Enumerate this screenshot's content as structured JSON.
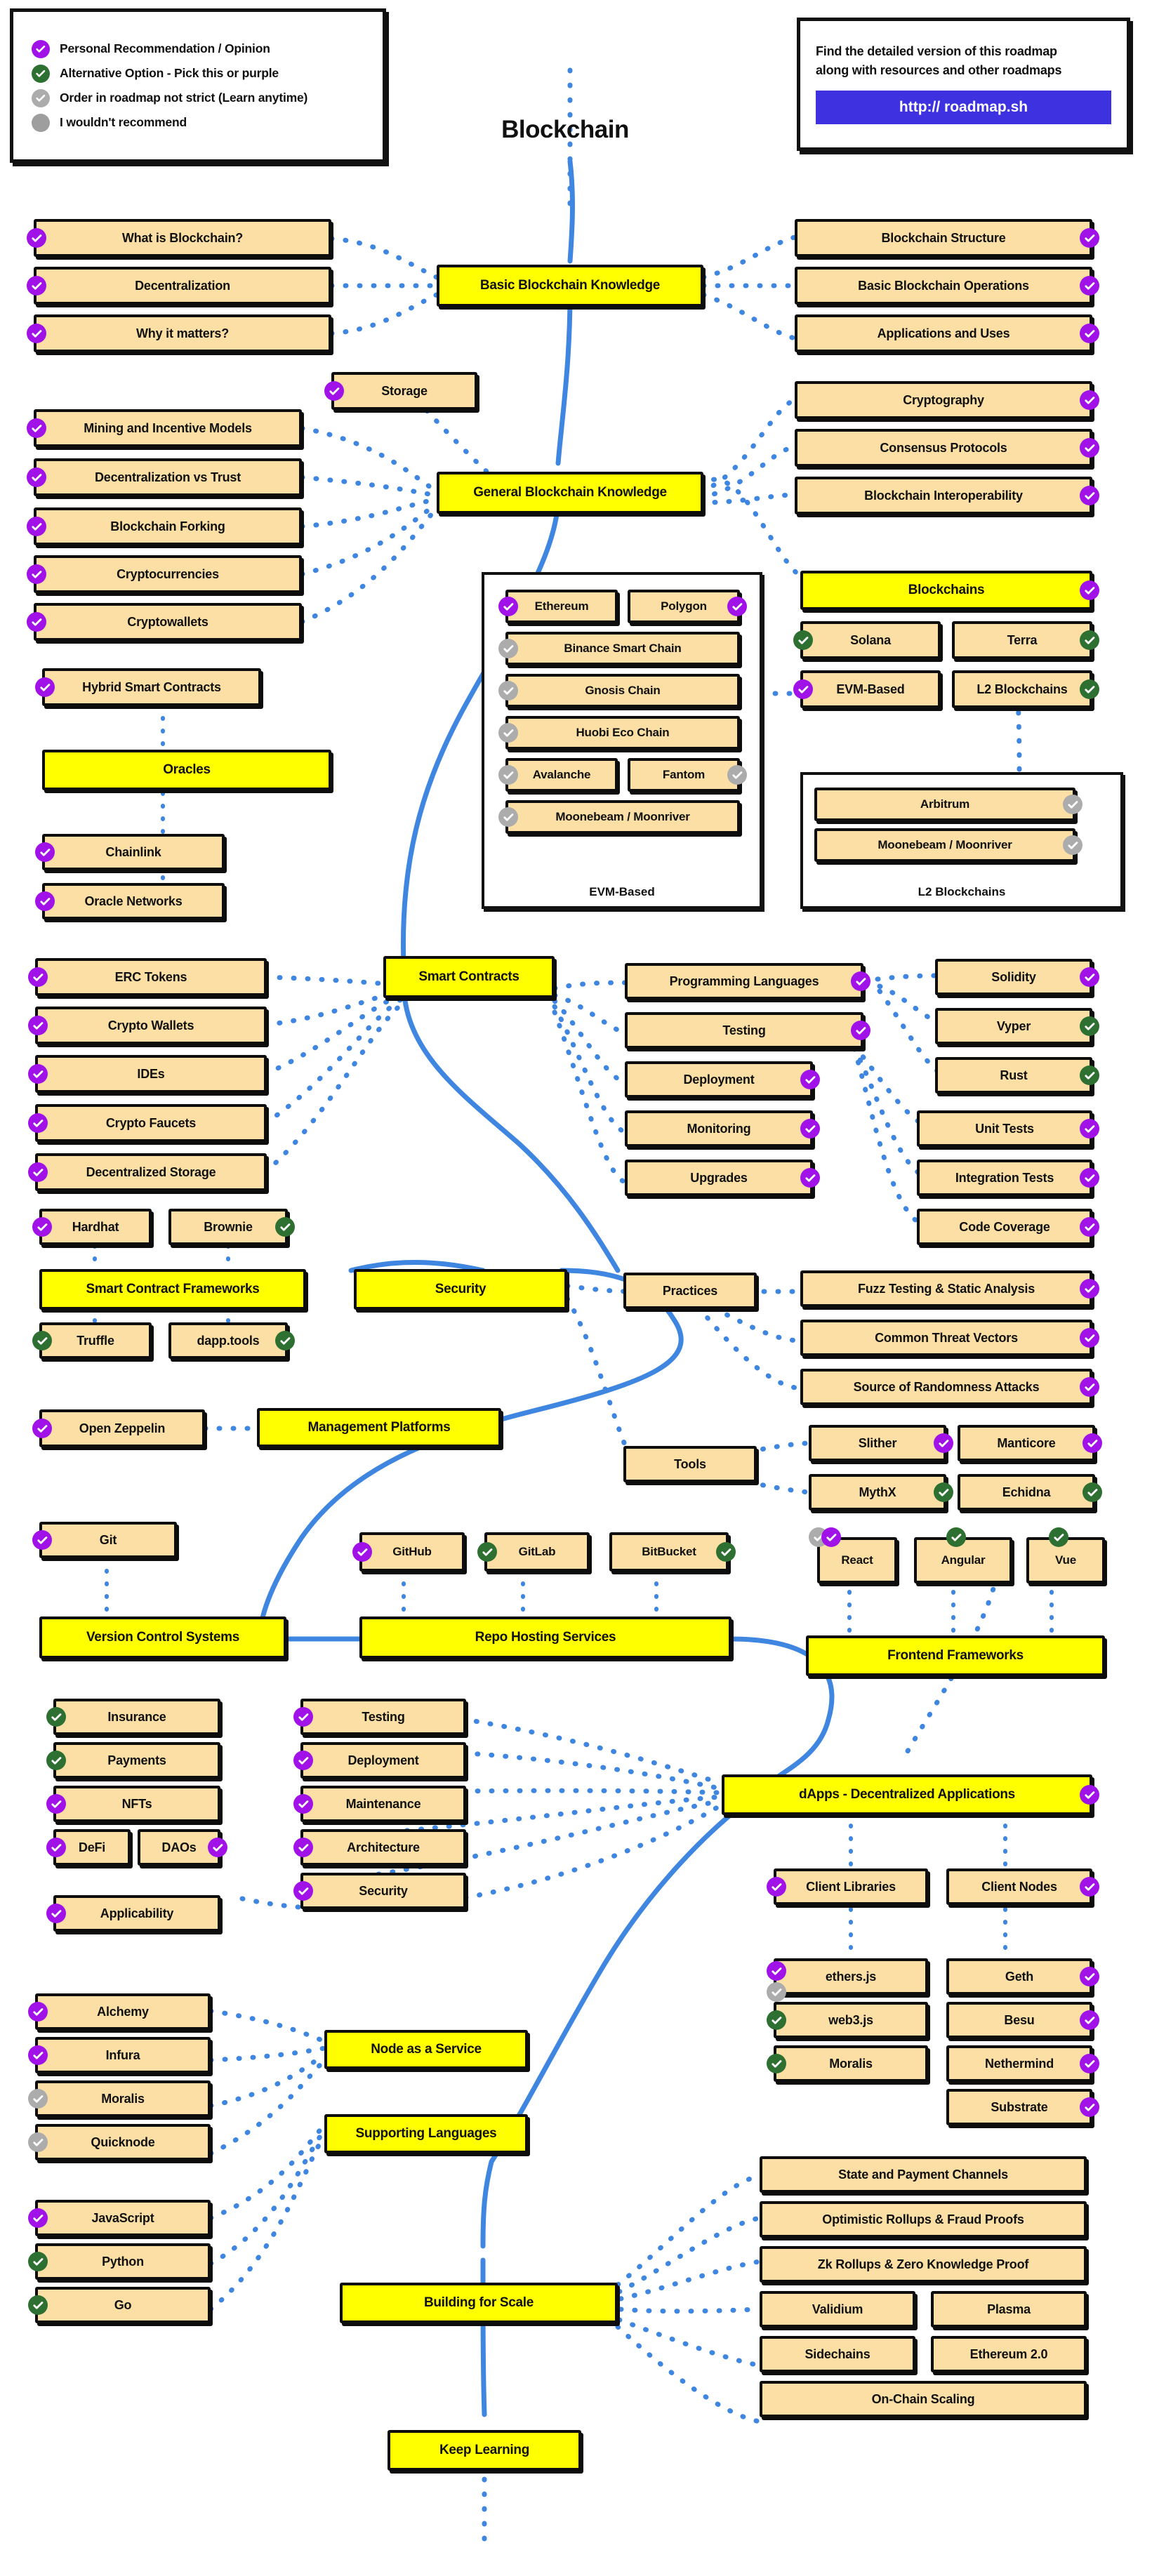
{
  "title": "Blockchain",
  "legend": {
    "items": [
      {
        "color": "purple",
        "icon": "check-circle-icon",
        "label": "Personal Recommendation / Opinion"
      },
      {
        "color": "green",
        "icon": "check-circle-icon",
        "label": "Alternative Option - Pick this or purple"
      },
      {
        "color": "gray",
        "icon": "check-circle-icon",
        "label": "Order in roadmap not strict (Learn anytime)"
      },
      {
        "color": "plain",
        "icon": "filled-circle-icon",
        "label": "I wouldn't recommend"
      }
    ]
  },
  "info": {
    "line1": "Find the detailed version of this roadmap",
    "line2": "along with resources and other roadmaps",
    "button": "http:// roadmap.sh"
  },
  "colors": {
    "purple": "#a112e8",
    "green": "#2e7031",
    "gray": "#acacac",
    "node_fill": "#fbdfa4",
    "main_fill": "#ffff00",
    "link_blue": "#3f86e0",
    "button_blue": "#3d31e0",
    "outline": "#0d0d0d"
  },
  "groups": [
    {
      "id": "evm_group",
      "caption": "EVM-Based"
    },
    {
      "id": "l2_group",
      "caption": "L2 Blockchains"
    }
  ],
  "nodes": [
    {
      "id": "n0",
      "label": "Basic Blockchain Knowledge",
      "main": true
    },
    {
      "id": "n1",
      "label": "What is Blockchain?"
    },
    {
      "id": "n2",
      "label": "Decentralization"
    },
    {
      "id": "n3",
      "label": "Why it matters?"
    },
    {
      "id": "n4",
      "label": "Blockchain Structure"
    },
    {
      "id": "n5",
      "label": "Basic Blockchain Operations"
    },
    {
      "id": "n6",
      "label": "Applications and Uses"
    },
    {
      "id": "n7",
      "label": "General Blockchain Knowledge",
      "main": true
    },
    {
      "id": "n8",
      "label": "Storage"
    },
    {
      "id": "n9",
      "label": "Mining and Incentive Models"
    },
    {
      "id": "n10",
      "label": "Decentralization vs Trust"
    },
    {
      "id": "n11",
      "label": "Blockchain Forking"
    },
    {
      "id": "n12",
      "label": "Cryptocurrencies"
    },
    {
      "id": "n13",
      "label": "Cryptowallets"
    },
    {
      "id": "n14",
      "label": "Cryptography"
    },
    {
      "id": "n15",
      "label": "Consensus Protocols"
    },
    {
      "id": "n16",
      "label": "Blockchain Interoperability"
    },
    {
      "id": "n17",
      "label": "Blockchains",
      "main": true
    },
    {
      "id": "n18",
      "label": "Solana"
    },
    {
      "id": "n19",
      "label": "Terra"
    },
    {
      "id": "n20",
      "label": "EVM-Based"
    },
    {
      "id": "n21",
      "label": "L2 Blockchains"
    },
    {
      "id": "n22",
      "label": "Ethereum"
    },
    {
      "id": "n23",
      "label": "Polygon"
    },
    {
      "id": "n24",
      "label": "Binance Smart Chain"
    },
    {
      "id": "n25",
      "label": "Gnosis Chain"
    },
    {
      "id": "n26",
      "label": "Huobi Eco Chain"
    },
    {
      "id": "n27",
      "label": "Avalanche"
    },
    {
      "id": "n28",
      "label": "Fantom"
    },
    {
      "id": "n29",
      "label": "Moonebeam / Moonriver"
    },
    {
      "id": "n30",
      "label": "Arbitrum"
    },
    {
      "id": "n31",
      "label": "Moonebeam / Moonriver"
    },
    {
      "id": "n32",
      "label": "Hybrid Smart Contracts"
    },
    {
      "id": "n33",
      "label": "Oracles",
      "main": true
    },
    {
      "id": "n34",
      "label": "Chainlink"
    },
    {
      "id": "n35",
      "label": "Oracle Networks"
    },
    {
      "id": "n36",
      "label": "Smart Contracts",
      "main": true
    },
    {
      "id": "n37",
      "label": "ERC Tokens"
    },
    {
      "id": "n38",
      "label": "Crypto Wallets"
    },
    {
      "id": "n39",
      "label": "IDEs"
    },
    {
      "id": "n40",
      "label": "Crypto Faucets"
    },
    {
      "id": "n41",
      "label": "Decentralized Storage"
    },
    {
      "id": "n42",
      "label": "Programming Languages"
    },
    {
      "id": "n43",
      "label": "Testing"
    },
    {
      "id": "n44",
      "label": "Deployment"
    },
    {
      "id": "n45",
      "label": "Monitoring"
    },
    {
      "id": "n46",
      "label": "Upgrades"
    },
    {
      "id": "n47",
      "label": "Solidity"
    },
    {
      "id": "n48",
      "label": "Vyper"
    },
    {
      "id": "n49",
      "label": "Rust"
    },
    {
      "id": "n50",
      "label": "Unit Tests"
    },
    {
      "id": "n51",
      "label": "Integration Tests"
    },
    {
      "id": "n52",
      "label": "Code Coverage"
    },
    {
      "id": "n53",
      "label": "Hardhat"
    },
    {
      "id": "n54",
      "label": "Brownie"
    },
    {
      "id": "n55",
      "label": "Smart Contract Frameworks",
      "main": true
    },
    {
      "id": "n56",
      "label": "Truffle"
    },
    {
      "id": "n57",
      "label": "dapp.tools"
    },
    {
      "id": "n58",
      "label": "Open Zeppelin"
    },
    {
      "id": "n59",
      "label": "Management Platforms",
      "main": true
    },
    {
      "id": "n60",
      "label": "Security",
      "main": true
    },
    {
      "id": "n61",
      "label": "Practices"
    },
    {
      "id": "n62",
      "label": "Tools"
    },
    {
      "id": "n63",
      "label": "Fuzz Testing & Static Analysis"
    },
    {
      "id": "n64",
      "label": "Common Threat Vectors"
    },
    {
      "id": "n65",
      "label": "Source of Randomness Attacks"
    },
    {
      "id": "n66",
      "label": "Slither"
    },
    {
      "id": "n67",
      "label": "Manticore"
    },
    {
      "id": "n68",
      "label": "MythX"
    },
    {
      "id": "n69",
      "label": "Echidna"
    },
    {
      "id": "n70",
      "label": "Git"
    },
    {
      "id": "n71",
      "label": "Version Control Systems",
      "main": true
    },
    {
      "id": "n72",
      "label": "GitHub"
    },
    {
      "id": "n73",
      "label": "GitLab"
    },
    {
      "id": "n74",
      "label": "BitBucket"
    },
    {
      "id": "n75",
      "label": "Repo Hosting Services",
      "main": true
    },
    {
      "id": "n76",
      "label": "React"
    },
    {
      "id": "n77",
      "label": "Angular"
    },
    {
      "id": "n78",
      "label": "Vue"
    },
    {
      "id": "n79",
      "label": "Frontend Frameworks",
      "main": true
    },
    {
      "id": "n80",
      "label": "dApps - Decentralized Applications",
      "main": true
    },
    {
      "id": "n81",
      "label": "Insurance"
    },
    {
      "id": "n82",
      "label": "Payments"
    },
    {
      "id": "n83",
      "label": "NFTs"
    },
    {
      "id": "n84",
      "label": "DeFi"
    },
    {
      "id": "n85",
      "label": "DAOs"
    },
    {
      "id": "n86",
      "label": "Applicability"
    },
    {
      "id": "n87",
      "label": "Testing"
    },
    {
      "id": "n88",
      "label": "Deployment"
    },
    {
      "id": "n89",
      "label": "Maintenance"
    },
    {
      "id": "n90",
      "label": "Architecture"
    },
    {
      "id": "n91",
      "label": "Security"
    },
    {
      "id": "n92",
      "label": "Client Libraries"
    },
    {
      "id": "n93",
      "label": "Client Nodes"
    },
    {
      "id": "n94",
      "label": "ethers.js"
    },
    {
      "id": "n95",
      "label": "web3.js"
    },
    {
      "id": "n96",
      "label": "Moralis"
    },
    {
      "id": "n97",
      "label": "Geth"
    },
    {
      "id": "n98",
      "label": "Besu"
    },
    {
      "id": "n99",
      "label": "Nethermind"
    },
    {
      "id": "n100",
      "label": "Substrate"
    },
    {
      "id": "n101",
      "label": "Alchemy"
    },
    {
      "id": "n102",
      "label": "Infura"
    },
    {
      "id": "n103",
      "label": "Moralis"
    },
    {
      "id": "n104",
      "label": "Quicknode"
    },
    {
      "id": "n105",
      "label": "Node as a Service",
      "main": true
    },
    {
      "id": "n106",
      "label": "Supporting Languages",
      "main": true
    },
    {
      "id": "n107",
      "label": "JavaScript"
    },
    {
      "id": "n108",
      "label": "Python"
    },
    {
      "id": "n109",
      "label": "Go"
    },
    {
      "id": "n110",
      "label": "Building for Scale",
      "main": true
    },
    {
      "id": "n111",
      "label": "State and Payment Channels"
    },
    {
      "id": "n112",
      "label": "Optimistic Rollups & Fraud Proofs"
    },
    {
      "id": "n113",
      "label": "Zk Rollups & Zero Knowledge Proof"
    },
    {
      "id": "n114",
      "label": "Validium"
    },
    {
      "id": "n115",
      "label": "Plasma"
    },
    {
      "id": "n116",
      "label": "Sidechains"
    },
    {
      "id": "n117",
      "label": "Ethereum 2.0"
    },
    {
      "id": "n118",
      "label": "On-Chain Scaling"
    },
    {
      "id": "n119",
      "label": "Keep Learning",
      "main": true
    }
  ]
}
